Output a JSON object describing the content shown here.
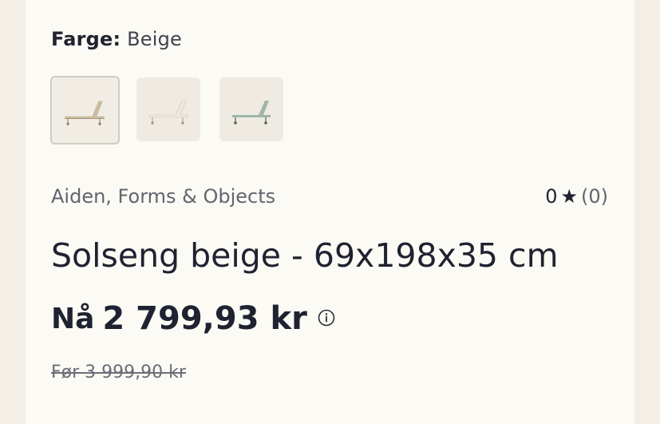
{
  "variant": {
    "label": "Farge:",
    "value": "Beige",
    "swatches": [
      {
        "name": "Beige",
        "color": "#cbbba1",
        "frame": "#a8987f",
        "selected": true
      },
      {
        "name": "White",
        "color": "#ece8e0",
        "frame": "#b9b7b2",
        "selected": false
      },
      {
        "name": "Green",
        "color": "#9eb6a8",
        "frame": "#6d7d74",
        "selected": false
      }
    ]
  },
  "product": {
    "brand": "Aiden, Forms & Objects",
    "rating_value": "0",
    "rating_star": "★",
    "rating_count": "(0)",
    "title": "Solseng beige - 69x198x35 cm"
  },
  "price": {
    "prefix": "Nå",
    "current": "2 799,93 kr",
    "before": "Før 3 999,90 kr",
    "info_icon": "info-circle-icon"
  }
}
